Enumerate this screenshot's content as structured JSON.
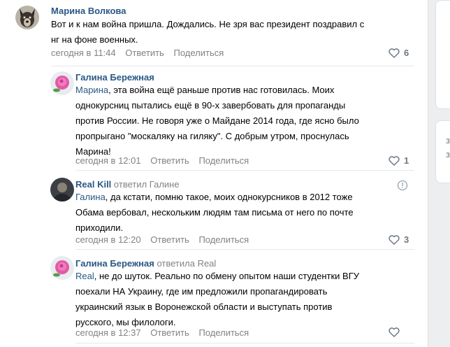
{
  "comments": [
    {
      "author": "Марина Волкова",
      "reply_to": "",
      "lines": [
        "Вот и к нам война пришла. Дождались. Не зря вас президент поздравил с",
        "нг на фоне военных."
      ],
      "time": "сегодня в 11:44",
      "reply_label": "Ответить",
      "share_label": "Поделиться",
      "likes": "6"
    },
    {
      "author": "Галина Бережная",
      "reply_to": "",
      "mention": "Марина",
      "lines": [
        ", эта война ещё раньше против нас готовилась. Моих",
        "однокурсниц пытались ещё в 90-х завербовать для пропаганды",
        "против России. Не говоря уже о Майдане 2014 года, где ясно было",
        "пропрыгано \"москаляку на гиляку\". С добрым утром, проснулась",
        "Марина!"
      ],
      "time": "сегодня в 12:01",
      "reply_label": "Ответить",
      "share_label": "Поделиться",
      "likes": "1"
    },
    {
      "author": "Real Kill",
      "reply_to": "ответил Галине",
      "mention": "Галина",
      "lines": [
        ", да кстати, помню такое, моих однокурсников в 2012 тоже",
        "Обама вербовал, нескольким людям там письма от него по почте",
        "приходили."
      ],
      "time": "сегодня в 12:20",
      "reply_label": "Ответить",
      "share_label": "Поделиться",
      "likes": "3"
    },
    {
      "author": "Галина Бережная",
      "reply_to": "ответила Real",
      "mention": "Real",
      "lines": [
        ", не до шуток. Реально по обмену опытом наши студентки ВГУ",
        "поехали НА Украину, где им предложили пропагандировать",
        "украинский язык в Воронежской области и выступать против",
        "русского, мы филологи."
      ],
      "time": "сегодня в 12:37",
      "reply_label": "Ответить",
      "share_label": "Поделиться",
      "likes": ""
    }
  ],
  "icons": {
    "like": "heart-icon",
    "report": "exclamation-circle-icon"
  },
  "side": {
    "glyph1": "з",
    "glyph2": "з"
  },
  "colors": {
    "link": "#2a5885",
    "meta": "#828282",
    "background": "#edeef0"
  }
}
